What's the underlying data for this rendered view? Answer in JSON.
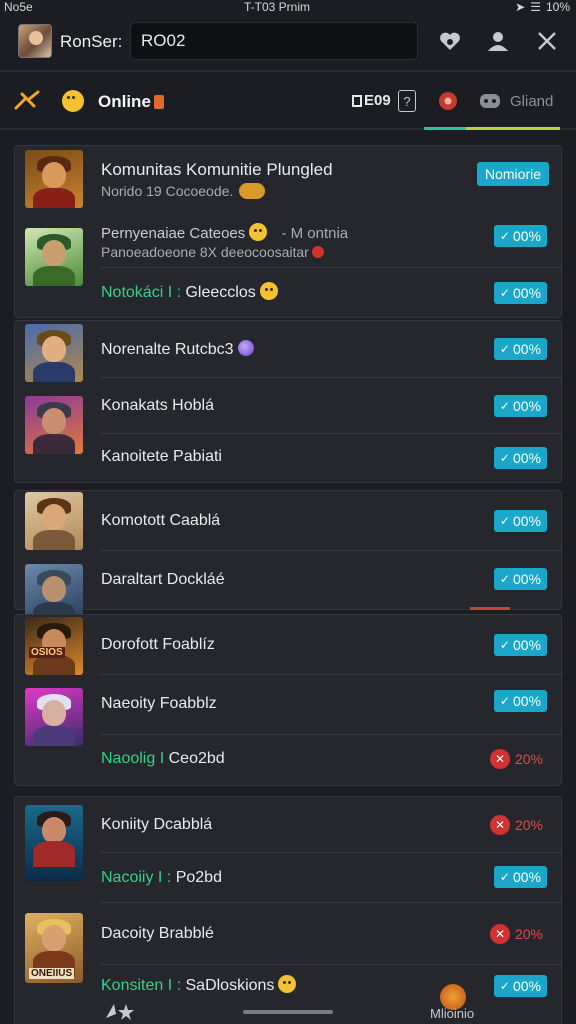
{
  "status": {
    "carrier": "No5e",
    "time": "T-T03 Prnim",
    "battery": "10%"
  },
  "header": {
    "app_name": "RonSer:",
    "search_value": "RO02"
  },
  "filter": {
    "online_label": "Online",
    "count_label": "E09",
    "tab_label": "Gliand"
  },
  "cards": [
    {
      "rows": [
        {
          "title": "Komunitas Komunitie Plungled",
          "subtitle": "Norido 19 Cocoeode.",
          "badge": "Nomiorie",
          "badge_type": "main",
          "thumb": "gold"
        },
        {
          "title": "Pernyenaiae Cateoes",
          "title_extra": "- M ontnia",
          "subtitle": "Panoeadoeone 8X deeocoosaitar",
          "badge": "00%",
          "badge_type": "pos",
          "thumb": "green"
        },
        {
          "title_green": "Notokáci I :",
          "title": "Gleecclos",
          "badge": "00%",
          "badge_type": "pos"
        }
      ]
    },
    {
      "rows": [
        {
          "title": "Norenalte Rutcbc3",
          "badge": "00%",
          "badge_type": "pos",
          "thumb": "blue"
        },
        {
          "title": "Konakats Hoblá",
          "badge": "00%",
          "badge_type": "pos",
          "thumb": "purple"
        },
        {
          "title": "Kanoitete Pabiati",
          "badge": "00%",
          "badge_type": "pos"
        }
      ]
    },
    {
      "rows": [
        {
          "title": "Komotott Caablá",
          "badge": "00%",
          "badge_type": "pos",
          "thumb": "tan"
        },
        {
          "title": "Daraltart Dockláé",
          "badge": "00%",
          "badge_type": "pos",
          "thumb": "steel"
        }
      ]
    },
    {
      "rows": [
        {
          "title": "Dorofott Foablíz",
          "badge": "00%",
          "badge_type": "pos",
          "thumb": "orange",
          "tag": "OSIOS"
        },
        {
          "title": "Naeoity Foabblz",
          "badge": "00%",
          "badge_type": "pos",
          "thumb": "magenta"
        },
        {
          "title_green": "Naoolig I",
          "title": "Ceo2bd",
          "badge": "20%",
          "badge_type": "neg"
        }
      ]
    },
    {
      "rows": [
        {
          "title": "Koniity Dcabblá",
          "badge": "20%",
          "badge_type": "neg",
          "thumb": "poster"
        },
        {
          "title_green": "Nacoiiy I :",
          "title": "Po2bd",
          "badge": "00%",
          "badge_type": "pos"
        },
        {
          "title": "Dacoity Brabblé",
          "badge": "20%",
          "badge_type": "neg",
          "thumb": "blond",
          "tag": "ONEIIUS"
        },
        {
          "title_green": "Konsiten I :",
          "title": "SaDloskions",
          "badge": "00%",
          "badge_type": "pos"
        }
      ]
    }
  ],
  "bottom": {
    "right_label": "Mlioinio"
  }
}
